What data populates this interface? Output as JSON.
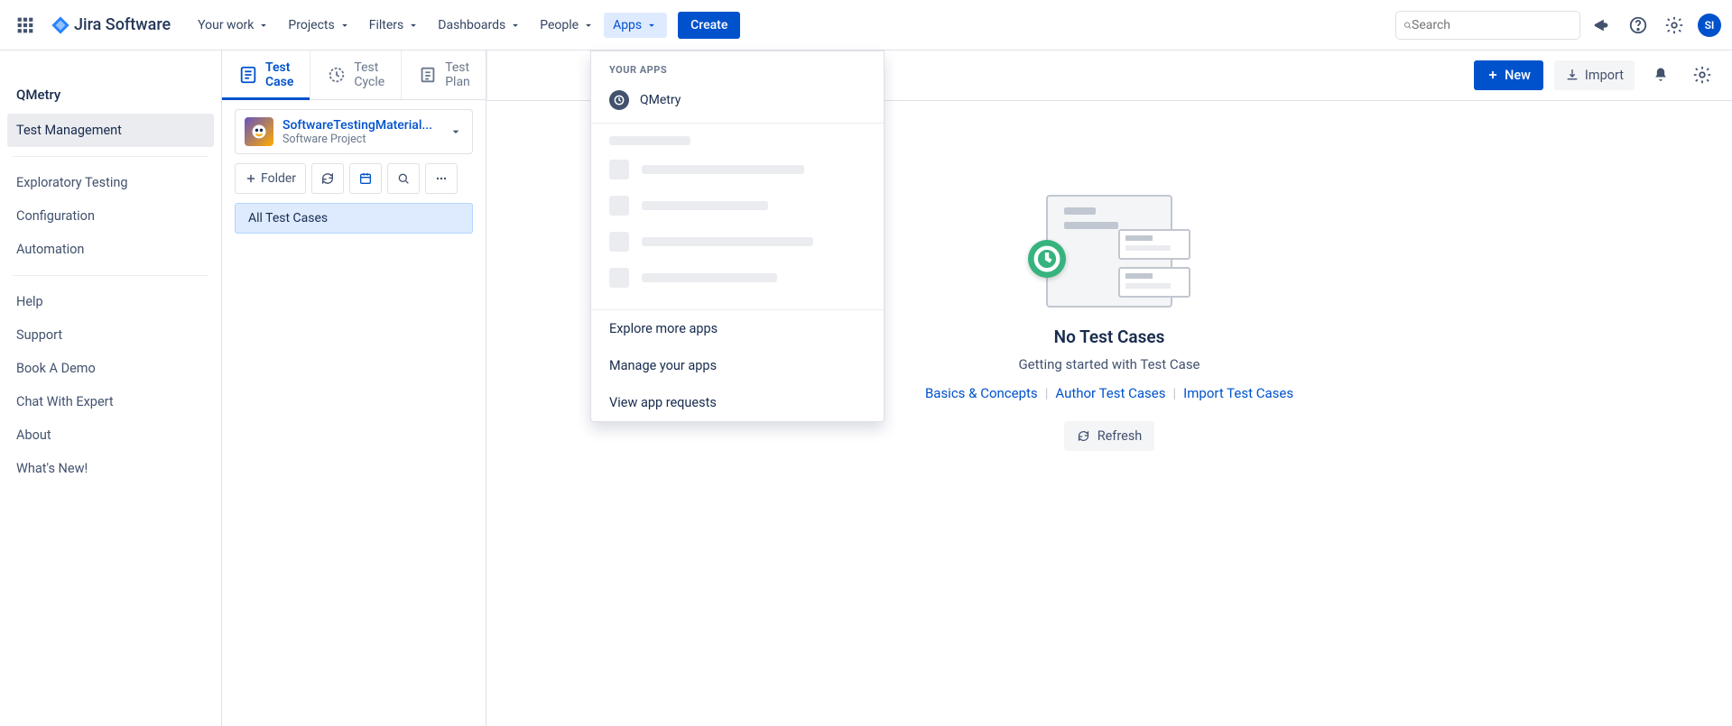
{
  "topbar": {
    "logo_text": "Jira Software",
    "nav": [
      "Your work",
      "Projects",
      "Filters",
      "Dashboards",
      "People",
      "Apps"
    ],
    "create": "Create",
    "search_placeholder": "Search",
    "avatar": "SI"
  },
  "dropdown": {
    "header": "YOUR APPS",
    "app": "QMetry",
    "links": [
      "Explore more apps",
      "Manage your apps",
      "View app requests"
    ]
  },
  "sidebar": {
    "title": "QMetry",
    "groups": [
      [
        "Test Management"
      ],
      [
        "Exploratory Testing",
        "Configuration",
        "Automation"
      ],
      [
        "Help",
        "Support",
        "Book A Demo",
        "Chat With Expert",
        "About",
        "What's New!"
      ]
    ]
  },
  "innerTabs": [
    "Test Case",
    "Test Cycle",
    "Test Plan"
  ],
  "project": {
    "name": "SoftwareTestingMaterial...",
    "sub": "Software Project"
  },
  "folder_btn": "Folder",
  "tree": "All Test Cases",
  "actions": {
    "new": "New",
    "import": "Import"
  },
  "empty": {
    "title": "No Test Cases",
    "sub": "Getting started with Test Case",
    "links": [
      "Basics & Concepts",
      "Author Test Cases",
      "Import Test Cases"
    ],
    "refresh": "Refresh"
  }
}
